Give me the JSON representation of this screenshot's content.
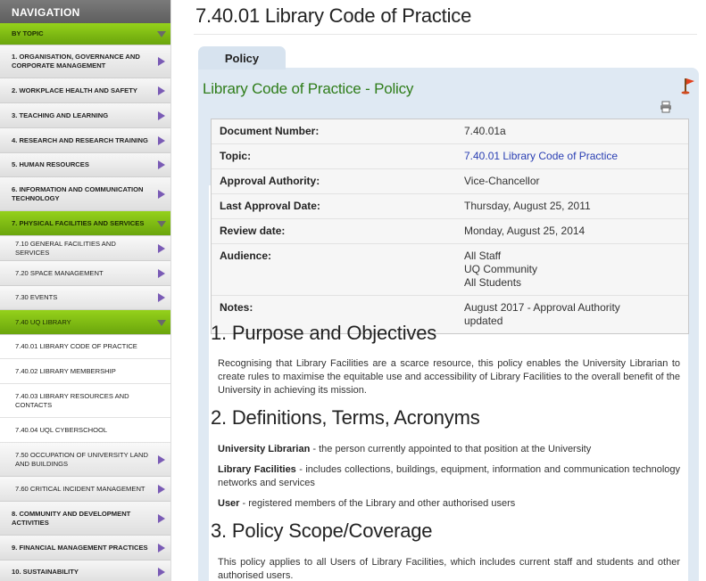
{
  "sidebar": {
    "heading": "NAVIGATION",
    "items": [
      {
        "label": "BY TOPIC"
      },
      {
        "label": "1. ORGANISATION, GOVERNANCE AND CORPORATE MANAGEMENT"
      },
      {
        "label": "2. WORKPLACE HEALTH AND SAFETY"
      },
      {
        "label": "3. TEACHING AND LEARNING"
      },
      {
        "label": "4. RESEARCH AND RESEARCH TRAINING"
      },
      {
        "label": "5. HUMAN RESOURCES"
      },
      {
        "label": "6. INFORMATION AND COMMUNICATION TECHNOLOGY"
      },
      {
        "label": "7. PHYSICAL FACILITIES AND SERVICES"
      },
      {
        "label": "7.10 GENERAL FACILITIES AND SERVICES"
      },
      {
        "label": "7.20 SPACE MANAGEMENT"
      },
      {
        "label": "7.30 EVENTS"
      },
      {
        "label": "7.40 UQ LIBRARY"
      },
      {
        "label": "7.40.01 LIBRARY CODE OF PRACTICE"
      },
      {
        "label": "7.40.02 LIBRARY MEMBERSHIP"
      },
      {
        "label": "7.40.03 LIBRARY RESOURCES AND CONTACTS"
      },
      {
        "label": "7.40.04 UQL CYBERSCHOOL"
      },
      {
        "label": "7.50 OCCUPATION OF UNIVERSITY LAND AND BUILDINGS"
      },
      {
        "label": "7.60 CRITICAL INCIDENT MANAGEMENT"
      },
      {
        "label": "8. COMMUNITY AND DEVELOPMENT ACTIVITIES"
      },
      {
        "label": "9. FINANCIAL MANAGEMENT PRACTICES"
      },
      {
        "label": "10. SUSTAINABILITY"
      }
    ]
  },
  "page": {
    "title": "7.40.01 Library Code of Practice",
    "tab_label": "Policy",
    "policy_heading": "Library Code of Practice - Policy"
  },
  "meta": {
    "document_number_label": "Document Number:",
    "document_number_value": "7.40.01a",
    "topic_label": "Topic:",
    "topic_value": "7.40.01 Library Code of Practice",
    "approval_authority_label": "Approval Authority:",
    "approval_authority_value": "Vice-Chancellor",
    "last_approval_label": "Last Approval Date:",
    "last_approval_value": "Thursday, August 25, 2011",
    "review_label": "Review date:",
    "review_value": "Monday, August 25, 2014",
    "audience_label": "Audience:",
    "audience_values": [
      "All Staff",
      "UQ Community",
      "All Students"
    ],
    "notes_label": "Notes:",
    "notes_value_line1": "August 2017 - Approval Authority",
    "notes_value_line2": "updated"
  },
  "sections": {
    "s1_heading": "1. Purpose and Objectives",
    "s1_text": "Recognising that Library Facilities are a scarce resource, this policy enables the University Librarian to create rules to maximise the equitable use and accessibility of Library Facilities to the overall benefit of the University in achieving its mission.",
    "s2_heading": "2. Definitions, Terms, Acronyms",
    "def1_term": "University Librarian",
    "def1_text": " - the person currently appointed to that position at the University",
    "def2_term": "Library Facilities",
    "def2_text": " - includes collections, buildings, equipment, information and communication technology networks and services",
    "def3_term": "User",
    "def3_text": " - registered members of the Library and other authorised users",
    "s3_heading": "3. Policy Scope/Coverage",
    "s3_text": "This policy applies to all Users of Library Facilities, which includes current staff and students and other authorised users."
  },
  "icons": {
    "flag": "flag-icon",
    "print": "print-icon",
    "nav_arrow_right": "chevron-right-icon",
    "nav_arrow_down": "chevron-down-icon"
  },
  "colors": {
    "nav_active": "#7fbf14",
    "policy_heading": "#2f7d1a",
    "link": "#2a3fb3",
    "panel": "#dfe9f3"
  }
}
